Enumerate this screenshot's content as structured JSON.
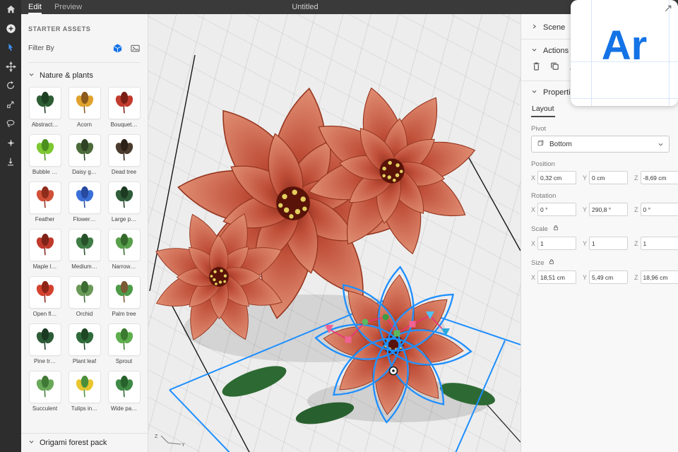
{
  "topbar": {
    "tabs": [
      {
        "label": "Edit",
        "active": true
      },
      {
        "label": "Preview",
        "active": false
      }
    ],
    "title": "Untitled"
  },
  "toolbar": {
    "tools": [
      {
        "name": "home",
        "icon": "home",
        "active": false
      },
      {
        "name": "add-asset",
        "icon": "add",
        "active": false
      },
      {
        "name": "select-tool",
        "icon": "select",
        "active": true
      },
      {
        "name": "move-tool",
        "icon": "move",
        "active": false
      },
      {
        "name": "rotate-tool",
        "icon": "rotate",
        "active": false
      },
      {
        "name": "scale-tool",
        "icon": "scale",
        "active": false
      },
      {
        "name": "lasso-tool",
        "icon": "lasso",
        "active": false
      },
      {
        "name": "pan-tool",
        "icon": "pan",
        "active": false
      },
      {
        "name": "drop-tool",
        "icon": "drop",
        "active": false
      }
    ]
  },
  "assets_panel": {
    "title": "STARTER ASSETS",
    "filter_label": "Filter By",
    "filters": [
      {
        "name": "filter-3d-objects",
        "icon": "cube",
        "active": true
      },
      {
        "name": "filter-images",
        "icon": "image",
        "active": false
      }
    ],
    "section": "Nature & plants",
    "items": [
      {
        "label": "Abstract…",
        "c1": "#2e5d34",
        "c2": "#1d4023"
      },
      {
        "label": "Acorn",
        "c1": "#e0a32e",
        "c2": "#8a5a1d"
      },
      {
        "label": "Bouquet…",
        "c1": "#c23b2e",
        "c2": "#7a1f16"
      },
      {
        "label": "Bubble …",
        "c1": "#7ec832",
        "c2": "#4c8f1e"
      },
      {
        "label": "Daisy g…",
        "c1": "#4c6b3a",
        "c2": "#2f4424"
      },
      {
        "label": "Dead tree",
        "c1": "#4a3b2e",
        "c2": "#2c2017"
      },
      {
        "label": "Feather",
        "c1": "#d05038",
        "c2": "#8f2c1c"
      },
      {
        "label": "Flower…",
        "c1": "#3a6fd8",
        "c2": "#274a9e"
      },
      {
        "label": "Large p…",
        "c1": "#2f5d3a",
        "c2": "#1c3b22"
      },
      {
        "label": "Maple l…",
        "c1": "#c0392b",
        "c2": "#7e2318"
      },
      {
        "label": "Medium…",
        "c1": "#3f7d46",
        "c2": "#275229"
      },
      {
        "label": "Narrow…",
        "c1": "#59a04c",
        "c2": "#35692c"
      },
      {
        "label": "Open fl…",
        "c1": "#d3422e",
        "c2": "#8d2417"
      },
      {
        "label": "Orchid",
        "c1": "#6a9a58",
        "c2": "#3c6b34"
      },
      {
        "label": "Palm tree",
        "c1": "#4e9a48",
        "c2": "#7a5a32"
      },
      {
        "label": "Pine tr…",
        "c1": "#2d5c38",
        "c2": "#1b3a22"
      },
      {
        "label": "Plant leaf",
        "c1": "#2f6b3a",
        "c2": "#1e4724"
      },
      {
        "label": "Sprout",
        "c1": "#5fae4e",
        "c2": "#3a7a30"
      },
      {
        "label": "Succulent",
        "c1": "#6aa95a",
        "c2": "#417a36"
      },
      {
        "label": "Tulips in…",
        "c1": "#e8c62e",
        "c2": "#4c8f3a"
      },
      {
        "label": "Wide pa…",
        "c1": "#3f8a46",
        "c2": "#27612c"
      }
    ],
    "footer_section": "Origami forest pack"
  },
  "viewport": {
    "axis_labels": [
      "Z",
      "Y"
    ]
  },
  "right_panel": {
    "scene_label": "Scene",
    "actions_label": "Actions",
    "actions": [
      {
        "name": "delete-action",
        "icon": "trash"
      },
      {
        "name": "duplicate-action",
        "icon": "duplicate"
      },
      {
        "name": "download-action",
        "icon": "download"
      }
    ],
    "properties_label": "Properties",
    "layout_tab": "Layout",
    "pivot_label": "Pivot",
    "pivot_value": "Bottom",
    "axis": {
      "x": "X",
      "y": "Y",
      "z": "Z"
    },
    "position": {
      "label": "Position",
      "x": "0,32 cm",
      "y": "0 cm",
      "z": "-8,69 cm"
    },
    "rotation": {
      "label": "Rotation",
      "x": "0 °",
      "y": "290,8 °",
      "z": "0 °"
    },
    "scale": {
      "label": "Scale",
      "locked": true,
      "x": "1",
      "y": "1",
      "z": "1"
    },
    "size": {
      "label": "Size",
      "locked": true,
      "x": "18,51 cm",
      "y": "5,49 cm",
      "z": "18,96 cm"
    }
  },
  "logo_card": {
    "text": "Ar"
  },
  "colors": {
    "accent": "#1473e6",
    "selection": "#1e8fff",
    "flower": "#c2503a",
    "topbar_bg": "#3a3a3a",
    "rail_bg": "#2d2d2d",
    "panel_bg": "#f5f5f5"
  }
}
